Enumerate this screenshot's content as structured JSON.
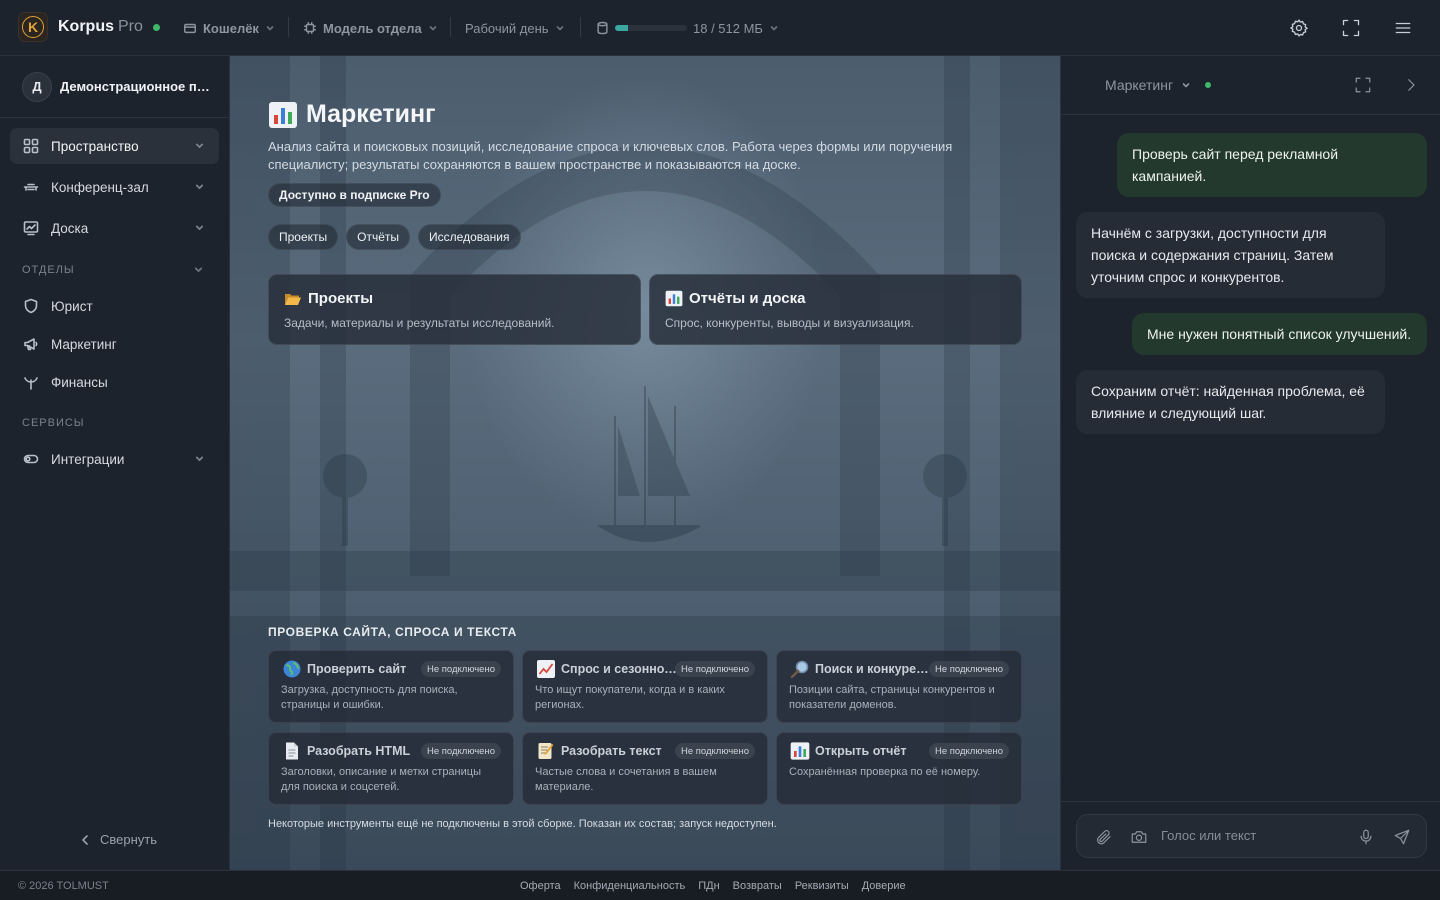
{
  "topbar": {
    "logo_letter": "K",
    "brand": "Korpus",
    "brand_suffix": "Pro",
    "wallet_label": "Кошелёк",
    "model_label": "Модель отдела",
    "mode_label": "Рабочий день",
    "storage_text": "18 / 512 МБ",
    "storage_fraction": 0.035
  },
  "sidebar": {
    "workspace_initial": "Д",
    "workspace_name": "Демонстрационное пространство",
    "items": [
      {
        "label": "Пространство"
      },
      {
        "label": "Конференц-зал"
      },
      {
        "label": "Доска"
      }
    ],
    "section_departments": "ОТДЕЛЫ",
    "departments": [
      {
        "label": "Юрист"
      },
      {
        "label": "Маркетинг"
      },
      {
        "label": "Финансы"
      }
    ],
    "section_services": "СЕРВИСЫ",
    "services": [
      {
        "label": "Интеграции"
      }
    ],
    "collapse_label": "Свернуть"
  },
  "main": {
    "title": "Маркетинг",
    "description": "Анализ сайта и поисковых позиций, исследование спроса и ключевых слов. Работа через формы или поручения специалисту; результаты сохраняются в вашем пространстве и показываются на доске.",
    "pro_badge": "Доступно в подписке Pro",
    "chips": [
      "Проекты",
      "Отчёты",
      "Исследования"
    ],
    "cards": [
      {
        "title": "Проекты",
        "desc": "Задачи, материалы и результаты исследований."
      },
      {
        "title": "Отчёты и доска",
        "desc": "Спрос, конкуренты, выводы и визуализация."
      }
    ],
    "section_title": "ПРОВЕРКА САЙТА, СПРОСА И ТЕКСТА",
    "tools": [
      {
        "title": "Проверить сайт",
        "badge": "Не подключено",
        "desc": "Загрузка, доступность для поиска, страницы и ошибки."
      },
      {
        "title": "Спрос и сезонность",
        "badge": "Не подключено",
        "desc": "Что ищут покупатели, когда и в каких регионах."
      },
      {
        "title": "Поиск и конкуренты",
        "badge": "Не подключено",
        "desc": "Позиции сайта, страницы конкурентов и показатели доменов."
      },
      {
        "title": "Разобрать HTML",
        "badge": "Не подключено",
        "desc": "Заголовки, описание и метки страницы для поиска и соцсетей."
      },
      {
        "title": "Разобрать текст",
        "badge": "Не подключено",
        "desc": "Частые слова и сочетания в вашем материале."
      },
      {
        "title": "Открыть отчёт",
        "badge": "Не подключено",
        "desc": "Сохранённая проверка по её номеру."
      }
    ],
    "footnote": "Некоторые инструменты ещё не подключены в этой сборке. Показан их состав; запуск недоступен."
  },
  "chat": {
    "department": "Маркетинг",
    "messages": [
      {
        "role": "user",
        "text": "Проверь сайт перед рекламной кампанией."
      },
      {
        "role": "bot",
        "text": "Начнём с загрузки, доступности для поиска и содержания страниц. Затем уточним спрос и конкурентов."
      },
      {
        "role": "user",
        "text": "Мне нужен понятный список улучшений."
      },
      {
        "role": "bot",
        "text": "Сохраним отчёт: найденная проблема, её влияние и следующий шаг."
      }
    ],
    "input_placeholder": "Голос или текст"
  },
  "footer": {
    "copyright": "© 2026 TOLMUST",
    "links": [
      "Оферта",
      "Конфиденциальность",
      "ПДн",
      "Возвраты",
      "Реквизиты",
      "Доверие"
    ]
  },
  "colors": {
    "accent_green": "#3fb86b",
    "logo_gold": "#e0a23a",
    "storage_teal": "#3aa8a0",
    "user_bubble": "#24392e"
  }
}
